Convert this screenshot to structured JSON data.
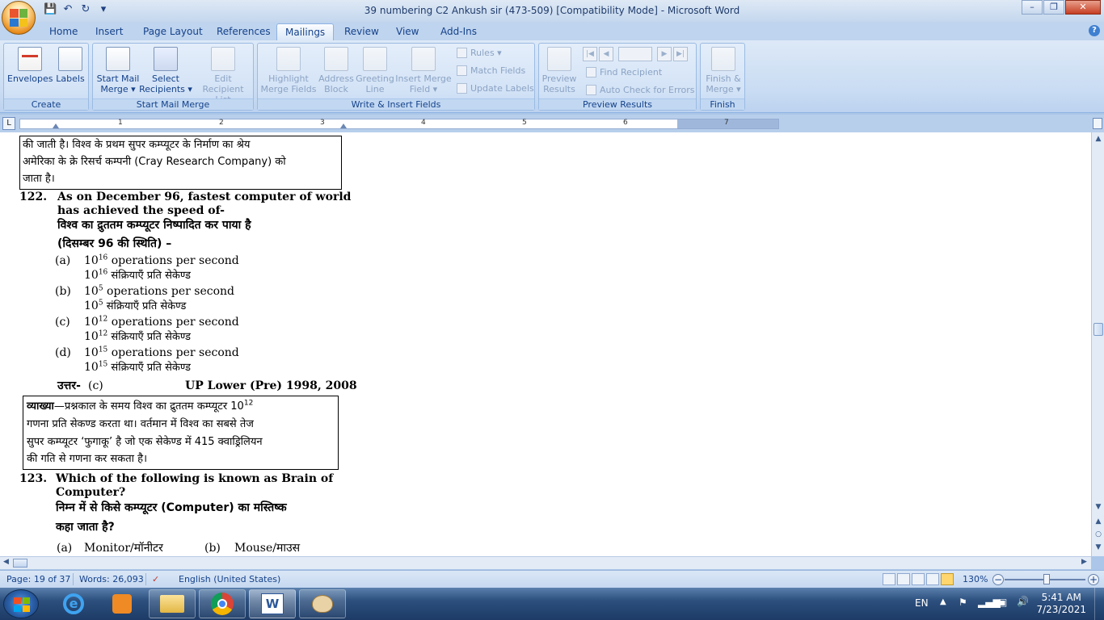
{
  "window": {
    "title": "39 numbering C2 Ankush sir (473-509) [Compatibility Mode] - Microsoft Word",
    "minimize": "–",
    "restore": "❐",
    "close": "✕"
  },
  "tabs": [
    "Home",
    "Insert",
    "Page Layout",
    "References",
    "Mailings",
    "Review",
    "View",
    "Add-Ins"
  ],
  "active_tab": "Mailings",
  "ribbon": {
    "create": {
      "label": "Create",
      "envelopes": "Envelopes",
      "labels": "Labels"
    },
    "start_mail_merge": {
      "label": "Start Mail Merge",
      "start_l1": "Start Mail",
      "start_l2": "Merge ▾",
      "select_l1": "Select",
      "select_l2": "Recipients ▾",
      "edit_l1": "Edit",
      "edit_l2": "Recipient List"
    },
    "write_insert": {
      "label": "Write & Insert Fields",
      "highlight_l1": "Highlight",
      "highlight_l2": "Merge Fields",
      "address_l1": "Address",
      "address_l2": "Block",
      "greeting_l1": "Greeting",
      "greeting_l2": "Line",
      "insert_l1": "Insert Merge",
      "insert_l2": "Field ▾",
      "rules": "Rules ▾",
      "match": "Match Fields",
      "update": "Update Labels"
    },
    "preview": {
      "label": "Preview Results",
      "preview_l1": "Preview",
      "preview_l2": "Results",
      "find": "Find Recipient",
      "auto_check": "Auto Check for Errors"
    },
    "finish": {
      "label": "Finish",
      "finish_l1": "Finish &",
      "finish_l2": "Merge ▾"
    }
  },
  "ruler": {
    "corner": "L",
    "numbers": [
      "1",
      "2",
      "3",
      "4",
      "5",
      "6",
      "7"
    ]
  },
  "document": {
    "box1_line1": "की जाती है। विश्व के प्रथम सुपर कम्प्यूटर के निर्माण का श्रेय",
    "box1_line2": "अमेरिका के क्रे रिसर्च कम्पनी (Cray Research Company) को",
    "box1_line3": "जाता है।",
    "q122_num": "122.",
    "q122_en1": "As on December 96, fastest computer of world",
    "q122_en2": "has achieved the speed of-",
    "q122_hi1": "विश्व का द्रुततम कम्प्यूटर निष्पादित कर पाया है",
    "q122_hi2": "(दिसम्बर 96 की स्थिति) –",
    "options": [
      {
        "key": "(a)",
        "base": "10",
        "exp": "16",
        "en": " operations per second",
        "hi": " संक्रियाएँ प्रति सेकेण्ड"
      },
      {
        "key": "(b)",
        "base": "10",
        "exp": "5",
        "en": " operations per second",
        "hi": " संक्रियाएँ प्रति सेकेण्ड"
      },
      {
        "key": "(c)",
        "base": "10",
        "exp": "12",
        "en": " operations per second",
        "hi": " संक्रियाएँ प्रति सेकेण्ड"
      },
      {
        "key": "(d)",
        "base": "10",
        "exp": "15",
        "en": " operations per second",
        "hi": " संक्रियाएँ प्रति सेकेण्ड"
      }
    ],
    "answer_label": "उत्तर-",
    "answer_value": "(c)",
    "exam": "UP Lower (Pre) 1998, 2008",
    "exp_label": "व्याख्या",
    "exp_line1": "—प्रश्नकाल के समय विश्व का द्रुततम कम्प्यूटर 10",
    "exp_line1_sup": "12",
    "exp_line2": "गणना प्रति सेकण्ड करता था। वर्तमान में विश्व का सबसे तेज",
    "exp_line3": "सुपर कम्प्यूटर ‘फुगाकू’ है जो एक सेकेण्ड में 415 क्वाड्रिलियन",
    "exp_line4": "की गति से गणना कर सकता है।",
    "q123_num": "123.",
    "q123_en1": "Which of the following is known as Brain of",
    "q123_en2": "Computer?",
    "q123_hi1": "निम्न में से किसे कम्प्यूटर (Computer) का मस्तिष्क",
    "q123_hi2": "कहा जाता है?",
    "q123_a_key": "(a)",
    "q123_a": "Monitor/मॉनीटर",
    "q123_b_key": "(b)",
    "q123_b": "Mouse/माउस"
  },
  "statusbar": {
    "page": "Page: 19 of 37",
    "words": "Words: 26,093",
    "language": "English (United States)",
    "zoom": "130%"
  },
  "taskbar": {
    "language": "EN",
    "time": "5:41 AM",
    "date": "7/23/2021"
  }
}
